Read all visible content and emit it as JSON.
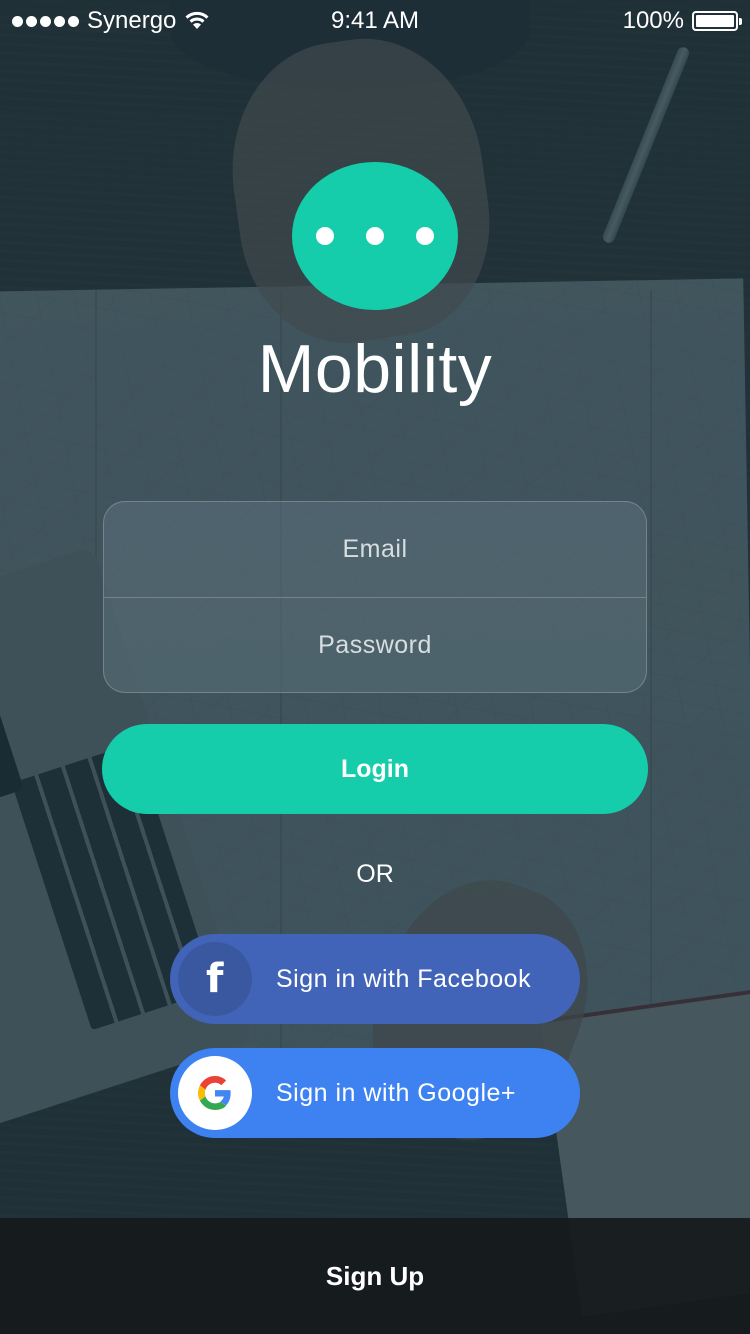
{
  "status_bar": {
    "carrier": "Synergo",
    "time": "9:41 AM",
    "battery": "100%",
    "battery_level": 1.0
  },
  "app": {
    "title": "Mobility",
    "accent_color": "#15cdaa"
  },
  "login_form": {
    "email_placeholder": "Email",
    "email_value": "",
    "password_placeholder": "Password",
    "password_value": "",
    "login_label": "Login"
  },
  "divider_text": "OR",
  "social": {
    "facebook_label": "Sign in with Facebook",
    "facebook_color": "#4264b8",
    "facebook_icon": "facebook-icon",
    "google_label": "Sign in with Google+",
    "google_color": "#3e82f2",
    "google_icon": "google-icon"
  },
  "footer": {
    "signup_label": "Sign Up"
  }
}
